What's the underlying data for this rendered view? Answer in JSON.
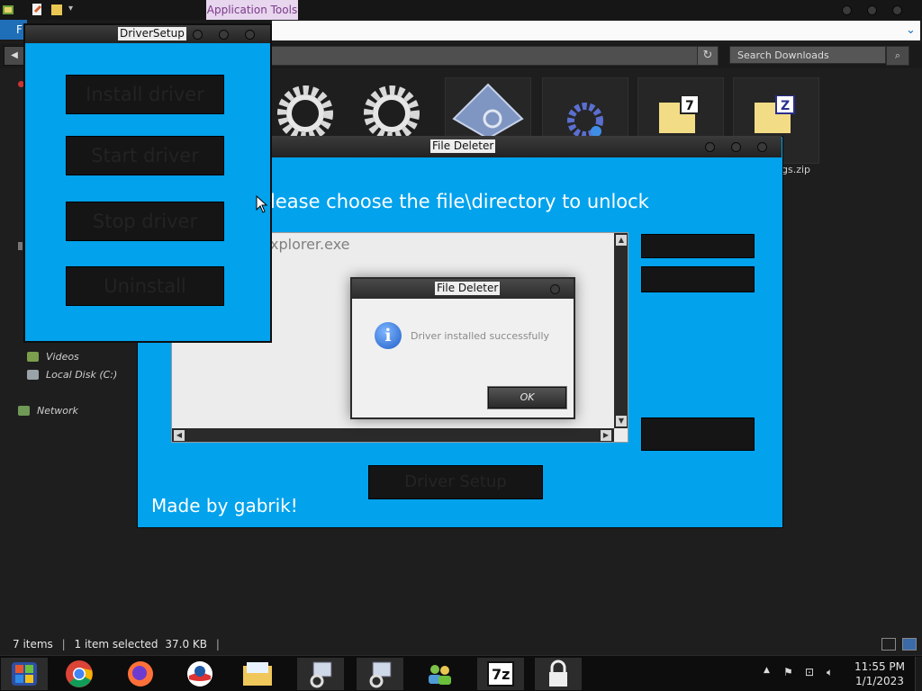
{
  "explorer": {
    "context_tab": "Application Tools",
    "file_tab": "F",
    "search_placeholder": "Search Downloads",
    "nav": [
      {
        "label": "Videos",
        "icon": "videos-library-icon"
      },
      {
        "label": "Local Disk (C:)",
        "icon": "local-disk-icon"
      },
      {
        "label": "Network",
        "icon": "network-icon"
      }
    ],
    "partial_file_name": "gs.zip",
    "status": {
      "items": "7 items",
      "selected": "1 item selected",
      "size": "37.0 KB"
    }
  },
  "file_deleter": {
    "title": "File Deleter",
    "prompt": "lease choose the file\\directory to unlock",
    "list_item": "xplorer.exe",
    "driver_setup_label": "Driver Setup",
    "credit": "Made by gabrik!"
  },
  "message_box": {
    "title": "File Deleter",
    "message": "Driver installed successfully",
    "ok_label": "OK",
    "icon": "info-icon"
  },
  "driver_setup": {
    "title": "DriverSetup",
    "buttons": [
      "Install driver",
      "Start driver",
      "Stop driver",
      "Uninstall"
    ]
  },
  "taskbar": {
    "time": "11:55 PM",
    "date": "1/1/2023"
  },
  "colors": {
    "app_accent": "#02a2ec",
    "dark_button": "#151515",
    "explorer_bg": "#1e1e1e"
  }
}
